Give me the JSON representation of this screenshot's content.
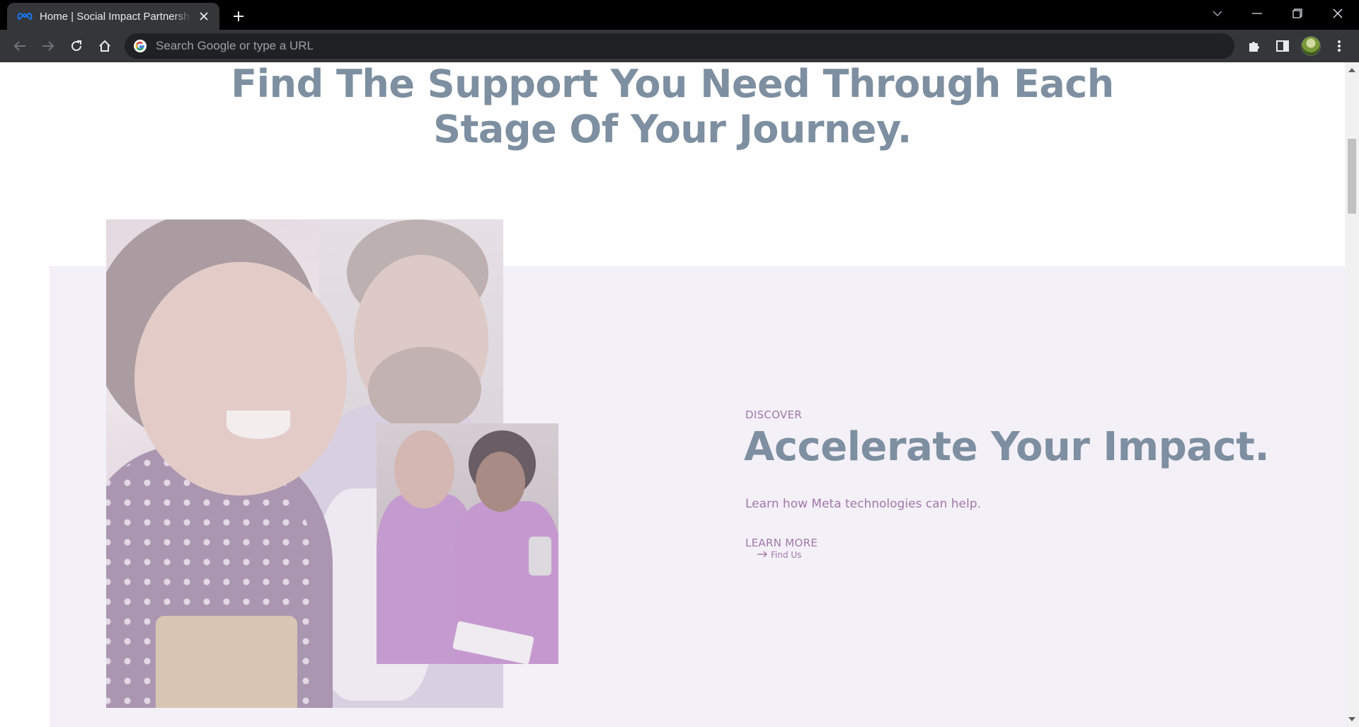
{
  "browser": {
    "tab_title": "Home | Social Impact Partnership",
    "omnibox_placeholder": "Search Google or type a URL"
  },
  "page": {
    "hero_heading_line1": "Find The Support You Need Through Each",
    "hero_heading_line2": "Stage Of Your Journey.",
    "feature": {
      "eyebrow": "DISCOVER",
      "heading": "Accelerate Your Impact.",
      "subtext": "Learn how Meta technologies can help.",
      "cta_label": "LEARN MORE",
      "cta_sublabel": "Find Us"
    }
  },
  "colors": {
    "heading": "#7d8fa0",
    "accent_purple": "#a07aa8",
    "band_background": "#f4f0f8",
    "chrome_dark": "#35363a"
  },
  "icons": {
    "favicon": "meta-logo-icon",
    "tab_close": "close-icon",
    "new_tab": "plus-icon",
    "back": "arrow-left-icon",
    "forward": "arrow-right-icon",
    "reload": "reload-icon",
    "home": "home-icon",
    "omnibox": "google-g-icon",
    "extensions": "puzzle-icon",
    "side_panel": "side-panel-icon",
    "menu": "kebab-menu-icon",
    "cta_arrow": "arrow-right-icon"
  }
}
